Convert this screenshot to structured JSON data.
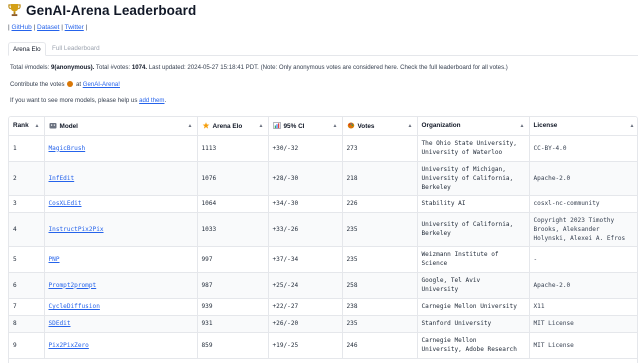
{
  "header": {
    "title": "GenAI-Arena Leaderboard",
    "links": [
      "GitHub",
      "Dataset",
      "Twitter"
    ]
  },
  "tabs": [
    "Arena Elo",
    "Full Leaderboard"
  ],
  "summary": {
    "total_models_label": "Total #models: ",
    "total_models_value": "9(anonymous).",
    "total_votes_label": " Total #votes: ",
    "total_votes_value": "1074.",
    "rest": " Last updated: 2024-05-27 15:18:41 PDT. (Note: Only anonymous votes are considered here. Check the full leaderboard for all votes.)"
  },
  "contribute": {
    "prefix": "Contribute the votes",
    "middle": " at ",
    "link": "GenAI-Arena!"
  },
  "more_models": {
    "prefix": "If you want to see more models, please help us ",
    "link": "add them",
    "suffix": "."
  },
  "table": {
    "columns": [
      "Rank",
      "Model",
      "Arena Elo",
      "95% CI",
      "Votes",
      "Organization",
      "License"
    ],
    "rows": [
      {
        "rank": "1",
        "model": "MagicBrush",
        "elo": "1113",
        "ci": "+30/-32",
        "votes": "273",
        "org": [
          "The Ohio State University,",
          "University of Waterloo"
        ],
        "license": [
          "CC-BY-4.0"
        ]
      },
      {
        "rank": "2",
        "model": "InfEdit",
        "elo": "1076",
        "ci": "+28/-30",
        "votes": "218",
        "org": [
          "University of Michigan,",
          "University of California,",
          "Berkeley"
        ],
        "license": [
          "Apache-2.0"
        ]
      },
      {
        "rank": "3",
        "model": "CosXLEdit",
        "elo": "1064",
        "ci": "+34/-30",
        "votes": "226",
        "org": [
          "Stability AI"
        ],
        "license": [
          "cosxl-nc-community"
        ]
      },
      {
        "rank": "4",
        "model": "InstructPix2Pix",
        "elo": "1033",
        "ci": "+33/-26",
        "votes": "235",
        "org": [
          "University of California,",
          "Berkeley"
        ],
        "license": [
          "Copyright 2023 Timothy",
          "Brooks, Aleksander",
          "Holynski, Alexei A. Efros"
        ]
      },
      {
        "rank": "5",
        "model": "PNP",
        "elo": "997",
        "ci": "+37/-34",
        "votes": "235",
        "org": [
          "Weizmann Institute of",
          "Science"
        ],
        "license": [
          "-"
        ]
      },
      {
        "rank": "6",
        "model": "Prompt2prompt",
        "elo": "987",
        "ci": "+25/-24",
        "votes": "258",
        "org": [
          "Google, Tel Aviv",
          "University"
        ],
        "license": [
          "Apache-2.0"
        ]
      },
      {
        "rank": "7",
        "model": "CycleDiffusion",
        "elo": "939",
        "ci": "+22/-27",
        "votes": "238",
        "org": [
          "Carnegie Mellon University"
        ],
        "license": [
          "X11"
        ]
      },
      {
        "rank": "8",
        "model": "SDEdit",
        "elo": "931",
        "ci": "+26/-20",
        "votes": "235",
        "org": [
          "Stanford University"
        ],
        "license": [
          "MIT License"
        ]
      },
      {
        "rank": "9",
        "model": "Pix2PixZero",
        "elo": "859",
        "ci": "+19/-25",
        "votes": "246",
        "org": [
          "Carnegie Mellon",
          "University, Adobe Research"
        ],
        "license": [
          "MIT License"
        ]
      }
    ]
  },
  "icons": {
    "title": "trophy-icon",
    "model_col": "robot-icon",
    "elo_col": "star-icon",
    "ci_col": "chart-icon",
    "votes_col": "paint-palette-icon",
    "contribute": "paint-palette-icon"
  },
  "colors": {
    "link": "#2563eb",
    "trophy": "#d4a017"
  }
}
